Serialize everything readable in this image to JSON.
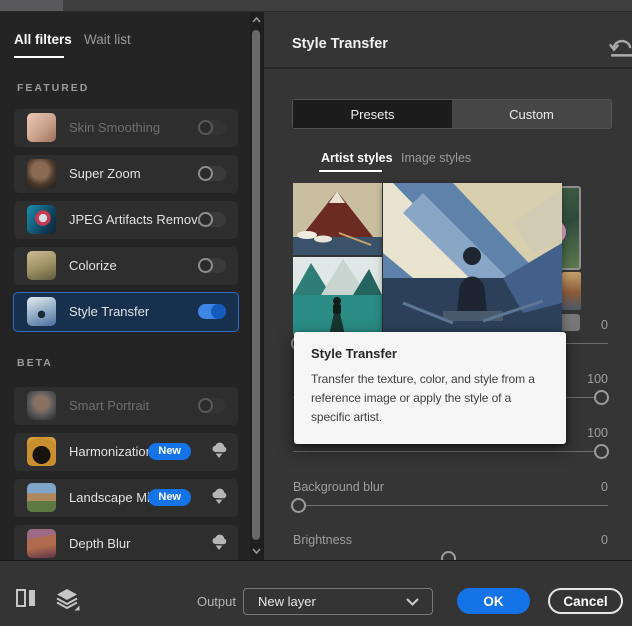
{
  "left_panel": {
    "tabs": [
      {
        "label": "All filters"
      },
      {
        "label": "Wait list"
      }
    ],
    "featured_title": "FEATURED",
    "beta_title": "BETA",
    "featured": [
      {
        "label": "Skin Smoothing",
        "toggle": "off",
        "disabled": true
      },
      {
        "label": "Super Zoom",
        "toggle": "off"
      },
      {
        "label": "JPEG Artifacts Removal",
        "toggle": "off"
      },
      {
        "label": "Colorize",
        "toggle": "off"
      },
      {
        "label": "Style Transfer",
        "toggle": "on",
        "selected": true
      }
    ],
    "beta": [
      {
        "label": "Smart Portrait",
        "toggle": "off",
        "disabled": true
      },
      {
        "label": "Harmonization",
        "badge": "New",
        "cloud_download": true
      },
      {
        "label": "Landscape Mixer",
        "badge": "New",
        "cloud_download": true
      },
      {
        "label": "Depth Blur",
        "cloud_download": true
      }
    ]
  },
  "right_panel": {
    "title": "Style Transfer",
    "segments": [
      {
        "label": "Presets",
        "active": true
      },
      {
        "label": "Custom",
        "active": false
      }
    ],
    "style_tabs": [
      {
        "label": "Artist styles",
        "active": true
      },
      {
        "label": "Image styles",
        "active": false
      }
    ],
    "tooltip": {
      "title": "Style Transfer",
      "body": "Transfer the texture, color, and style from a reference image or apply the style of a specific artist."
    },
    "sliders": [
      {
        "label": "",
        "value": "0"
      },
      {
        "label": "",
        "value": "100"
      },
      {
        "label": "",
        "value": "100"
      },
      {
        "label": "Background blur",
        "value": "0"
      },
      {
        "label": "Brightness",
        "value": "0"
      }
    ]
  },
  "footer": {
    "output_label": "Output",
    "output_value": "New layer",
    "ok_label": "OK",
    "cancel_label": "Cancel"
  },
  "colors": {
    "accent_blue": "#1473e6",
    "selected_item_bg": "#16304e",
    "selected_item_border": "#2e6fc4",
    "toggle_on": "#3c87e6",
    "tooltip_bg": "#f6f6f6",
    "panel_left_bg": "#242424",
    "panel_right_bg": "#353535"
  },
  "icons": {
    "reset": "undo arrow over line",
    "cloud_download": "cloud with down arrow",
    "split_view": "before/after split rectangle",
    "layers": "stacked layers with flyout triangle",
    "chevron_down": "v",
    "scroll_up": "^",
    "scroll_down": "v"
  }
}
